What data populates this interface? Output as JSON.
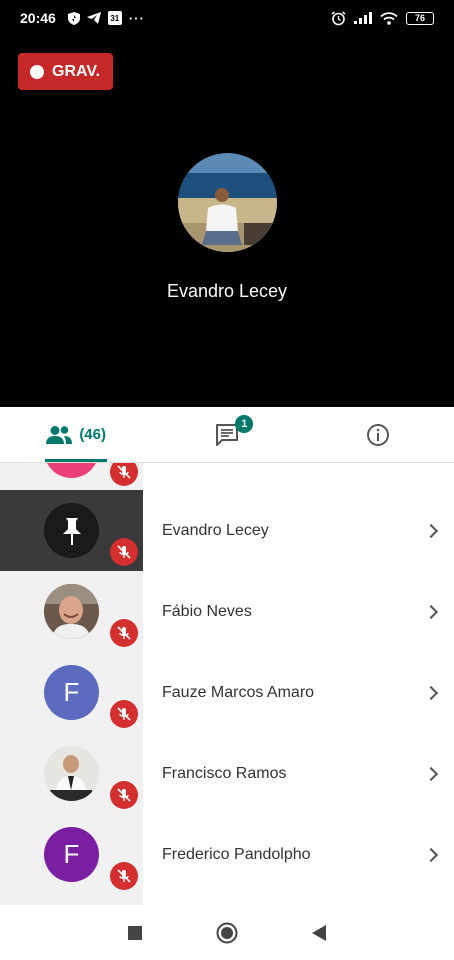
{
  "status_bar": {
    "time": "20:46",
    "left_icons": [
      "shield-icon",
      "telegram-icon",
      "calendar-icon",
      "more-dots-icon"
    ],
    "calendar_day": "31",
    "right_icons": [
      "alarm-icon",
      "signal-icon",
      "wifi-icon",
      "battery-icon"
    ],
    "battery": "76"
  },
  "recording": {
    "label": "GRAV.",
    "color": "#c62828"
  },
  "speaker": {
    "name": "Evandro Lecey"
  },
  "tabs": {
    "participants_count": "(46)",
    "chat_badge": "1",
    "accent": "#00796b"
  },
  "participants": [
    {
      "name": "",
      "avatar": "pink-avatar",
      "muted": true
    },
    {
      "name": "Evandro Lecey",
      "avatar": "pinned-photo",
      "muted": true,
      "active": true
    },
    {
      "name": "Fábio Neves",
      "avatar": "photo",
      "muted": true
    },
    {
      "name": "Fauze Marcos Amaro",
      "avatar": "letter",
      "initial": "F",
      "color": "#5c6bc0",
      "muted": true
    },
    {
      "name": "Francisco Ramos",
      "avatar": "photo",
      "muted": true
    },
    {
      "name": "Frederico Pandolpho",
      "avatar": "letter",
      "initial": "F",
      "color": "#7b1fa2",
      "muted": true
    }
  ],
  "navbar": {
    "buttons": [
      "recents-square-icon",
      "home-circle-icon",
      "back-triangle-icon"
    ]
  }
}
